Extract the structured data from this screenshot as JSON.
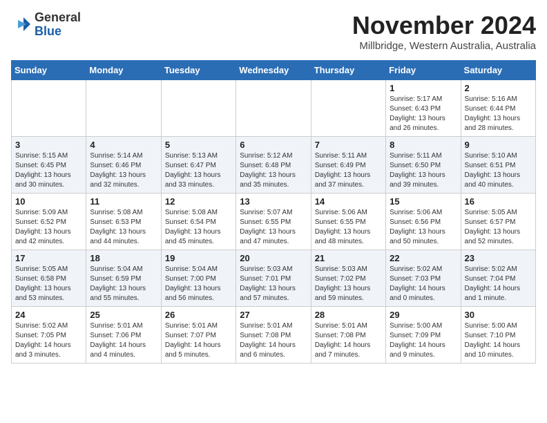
{
  "header": {
    "logo_general": "General",
    "logo_blue": "Blue",
    "month_title": "November 2024",
    "location": "Millbridge, Western Australia, Australia"
  },
  "days_of_week": [
    "Sunday",
    "Monday",
    "Tuesday",
    "Wednesday",
    "Thursday",
    "Friday",
    "Saturday"
  ],
  "weeks": [
    [
      {
        "day": "",
        "info": ""
      },
      {
        "day": "",
        "info": ""
      },
      {
        "day": "",
        "info": ""
      },
      {
        "day": "",
        "info": ""
      },
      {
        "day": "",
        "info": ""
      },
      {
        "day": "1",
        "info": "Sunrise: 5:17 AM\nSunset: 6:43 PM\nDaylight: 13 hours\nand 26 minutes."
      },
      {
        "day": "2",
        "info": "Sunrise: 5:16 AM\nSunset: 6:44 PM\nDaylight: 13 hours\nand 28 minutes."
      }
    ],
    [
      {
        "day": "3",
        "info": "Sunrise: 5:15 AM\nSunset: 6:45 PM\nDaylight: 13 hours\nand 30 minutes."
      },
      {
        "day": "4",
        "info": "Sunrise: 5:14 AM\nSunset: 6:46 PM\nDaylight: 13 hours\nand 32 minutes."
      },
      {
        "day": "5",
        "info": "Sunrise: 5:13 AM\nSunset: 6:47 PM\nDaylight: 13 hours\nand 33 minutes."
      },
      {
        "day": "6",
        "info": "Sunrise: 5:12 AM\nSunset: 6:48 PM\nDaylight: 13 hours\nand 35 minutes."
      },
      {
        "day": "7",
        "info": "Sunrise: 5:11 AM\nSunset: 6:49 PM\nDaylight: 13 hours\nand 37 minutes."
      },
      {
        "day": "8",
        "info": "Sunrise: 5:11 AM\nSunset: 6:50 PM\nDaylight: 13 hours\nand 39 minutes."
      },
      {
        "day": "9",
        "info": "Sunrise: 5:10 AM\nSunset: 6:51 PM\nDaylight: 13 hours\nand 40 minutes."
      }
    ],
    [
      {
        "day": "10",
        "info": "Sunrise: 5:09 AM\nSunset: 6:52 PM\nDaylight: 13 hours\nand 42 minutes."
      },
      {
        "day": "11",
        "info": "Sunrise: 5:08 AM\nSunset: 6:53 PM\nDaylight: 13 hours\nand 44 minutes."
      },
      {
        "day": "12",
        "info": "Sunrise: 5:08 AM\nSunset: 6:54 PM\nDaylight: 13 hours\nand 45 minutes."
      },
      {
        "day": "13",
        "info": "Sunrise: 5:07 AM\nSunset: 6:55 PM\nDaylight: 13 hours\nand 47 minutes."
      },
      {
        "day": "14",
        "info": "Sunrise: 5:06 AM\nSunset: 6:55 PM\nDaylight: 13 hours\nand 48 minutes."
      },
      {
        "day": "15",
        "info": "Sunrise: 5:06 AM\nSunset: 6:56 PM\nDaylight: 13 hours\nand 50 minutes."
      },
      {
        "day": "16",
        "info": "Sunrise: 5:05 AM\nSunset: 6:57 PM\nDaylight: 13 hours\nand 52 minutes."
      }
    ],
    [
      {
        "day": "17",
        "info": "Sunrise: 5:05 AM\nSunset: 6:58 PM\nDaylight: 13 hours\nand 53 minutes."
      },
      {
        "day": "18",
        "info": "Sunrise: 5:04 AM\nSunset: 6:59 PM\nDaylight: 13 hours\nand 55 minutes."
      },
      {
        "day": "19",
        "info": "Sunrise: 5:04 AM\nSunset: 7:00 PM\nDaylight: 13 hours\nand 56 minutes."
      },
      {
        "day": "20",
        "info": "Sunrise: 5:03 AM\nSunset: 7:01 PM\nDaylight: 13 hours\nand 57 minutes."
      },
      {
        "day": "21",
        "info": "Sunrise: 5:03 AM\nSunset: 7:02 PM\nDaylight: 13 hours\nand 59 minutes."
      },
      {
        "day": "22",
        "info": "Sunrise: 5:02 AM\nSunset: 7:03 PM\nDaylight: 14 hours\nand 0 minutes."
      },
      {
        "day": "23",
        "info": "Sunrise: 5:02 AM\nSunset: 7:04 PM\nDaylight: 14 hours\nand 1 minute."
      }
    ],
    [
      {
        "day": "24",
        "info": "Sunrise: 5:02 AM\nSunset: 7:05 PM\nDaylight: 14 hours\nand 3 minutes."
      },
      {
        "day": "25",
        "info": "Sunrise: 5:01 AM\nSunset: 7:06 PM\nDaylight: 14 hours\nand 4 minutes."
      },
      {
        "day": "26",
        "info": "Sunrise: 5:01 AM\nSunset: 7:07 PM\nDaylight: 14 hours\nand 5 minutes."
      },
      {
        "day": "27",
        "info": "Sunrise: 5:01 AM\nSunset: 7:08 PM\nDaylight: 14 hours\nand 6 minutes."
      },
      {
        "day": "28",
        "info": "Sunrise: 5:01 AM\nSunset: 7:08 PM\nDaylight: 14 hours\nand 7 minutes."
      },
      {
        "day": "29",
        "info": "Sunrise: 5:00 AM\nSunset: 7:09 PM\nDaylight: 14 hours\nand 9 minutes."
      },
      {
        "day": "30",
        "info": "Sunrise: 5:00 AM\nSunset: 7:10 PM\nDaylight: 14 hours\nand 10 minutes."
      }
    ]
  ]
}
